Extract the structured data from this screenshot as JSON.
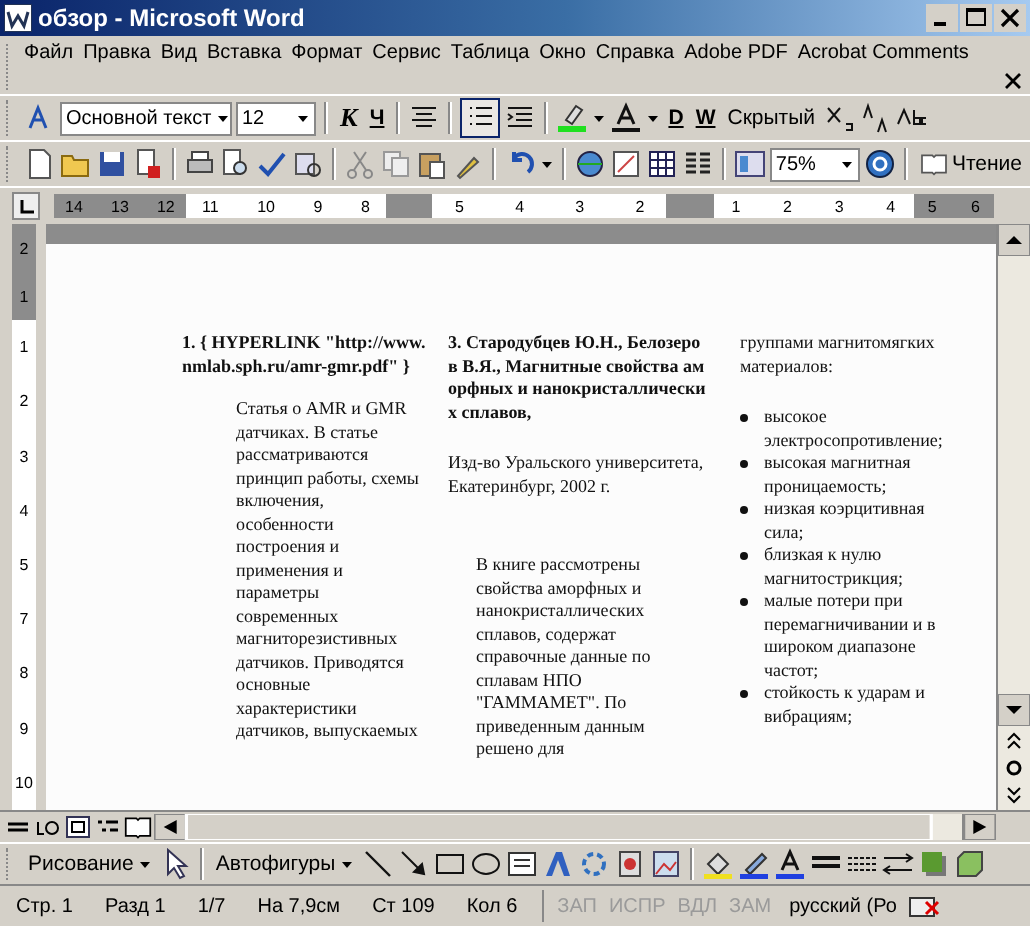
{
  "window": {
    "title": "обзор - Microsoft Word"
  },
  "menu": [
    "Файл",
    "Правка",
    "Вид",
    "Вставка",
    "Формат",
    "Сервис",
    "Таблица",
    "Окно",
    "Справка",
    "Adobe PDF",
    "Acrobat Comments"
  ],
  "formatting_toolbar": {
    "style": "Основной текст",
    "size": "12",
    "bold_italic": "К",
    "underline": "Ч",
    "bullets_pressed": true,
    "extra_buttons": [
      "D",
      "W",
      "Скрытый"
    ]
  },
  "standard_toolbar": {
    "zoom": "75%",
    "reading_button": "Чтение"
  },
  "ruler": {
    "segments": [
      {
        "margin": true,
        "labels": [
          "14",
          "13",
          "12"
        ]
      },
      {
        "margin": false,
        "labels": [
          "11",
          "10",
          "9",
          "8"
        ]
      },
      {
        "margin": true
      },
      {
        "margin": false,
        "labels": [
          "5",
          "4",
          "3",
          "2"
        ]
      },
      {
        "margin": true
      },
      {
        "margin": false,
        "labels": [
          "1",
          "2",
          "3",
          "4"
        ]
      },
      {
        "margin": true,
        "labels": [
          "5",
          "6"
        ]
      }
    ]
  },
  "vertical_ruler": {
    "segments": [
      {
        "margin": true,
        "labels": [
          "2",
          "1"
        ]
      },
      {
        "margin": false,
        "labels": [
          "1",
          "2",
          "3",
          "4",
          "5",
          "7",
          "8",
          "9",
          "10"
        ]
      }
    ]
  },
  "document": {
    "columns": [
      {
        "heading": "1. { HYPERLINK \"http://www.nmlab.sph.ru/amr-gmr.pdf\" }",
        "paragraphs": [
          "Статья о AMR и GMR датчиках. В статье рассматриваются принцип работы, схемы включения, особенности построения и применения и параметры современных магниторезистивных датчиков. Приводятся основные характеристики датчиков, выпускаемых"
        ]
      },
      {
        "heading": "3. Стародубцев Ю.Н., Белозеров В.Я., Магнитные свойства аморфных и нанокристаллических сплавов,",
        "paragraphs": [
          "Изд-во Уральского университета, Екатеринбург, 2002 г.",
          "В книге рассмотрены свойства аморфных и нанокристаллических сплавов, содержат справочные данные по сплавам НПО \"ГАММАМЕТ\". По приведенным данным решено для"
        ]
      },
      {
        "paragraphs": [
          "группами магнитомягких материалов:"
        ],
        "bullets": [
          "высокое электросопротивление;",
          "высокая магнитная проницаемость;",
          "низкая коэрцитивная сила;",
          "близкая к нулю магнитострикция;",
          "малые потери при перемагничивании и в широком диапазоне частот;",
          "стойкость к ударам и вибрациям;"
        ]
      }
    ]
  },
  "drawing_toolbar": {
    "drawing_menu": "Рисование",
    "autoshapes_menu": "Автофигуры"
  },
  "status_bar": {
    "fields": [
      "Стр. 1",
      "Разд 1",
      "1/7",
      "На 7,9см",
      "Ст 109",
      "Кол 6"
    ],
    "modes": [
      {
        "label": "ЗАП",
        "disabled": true
      },
      {
        "label": "ИСПР",
        "disabled": true
      },
      {
        "label": "ВДЛ",
        "disabled": true
      },
      {
        "label": "ЗАМ",
        "disabled": true
      }
    ],
    "language": "русский (Ро"
  }
}
